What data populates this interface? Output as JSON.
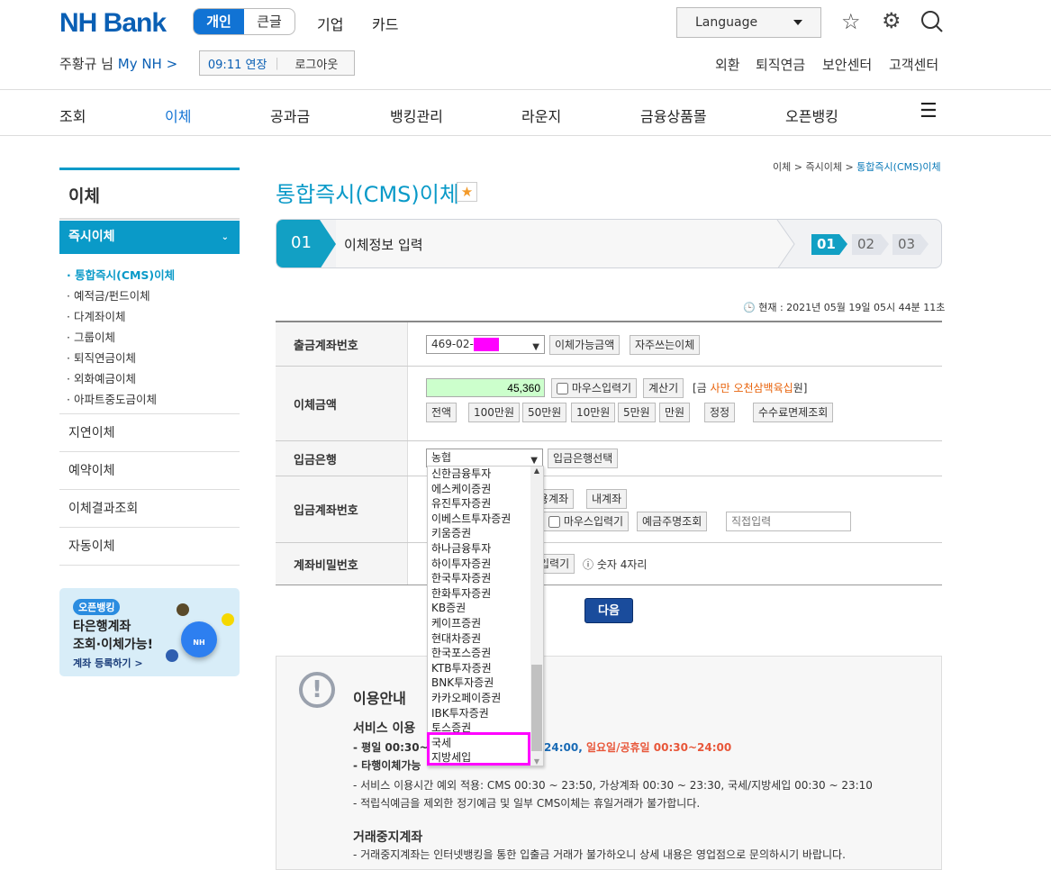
{
  "header": {
    "logo": "NH Bank",
    "segments": [
      "개인",
      "큰글"
    ],
    "nav": [
      "기업",
      "카드"
    ],
    "language": "Language",
    "user": "주황규 님",
    "my_nh": "My NH >",
    "session_extend": "09:11 연장",
    "logout": "로그아웃",
    "util": [
      "외환",
      "퇴직연금",
      "보안센터",
      "고객센터"
    ]
  },
  "gnb": [
    "조회",
    "이체",
    "공과금",
    "뱅킹관리",
    "라운지",
    "금융상품몰",
    "오픈뱅킹"
  ],
  "sidebar": {
    "title": "이체",
    "active": "즉시이체",
    "subitems": [
      "· 통합즉시(CMS)이체",
      "· 예적금/펀드이체",
      "· 다계좌이체",
      "· 그룹이체",
      "· 퇴직연금이체",
      "· 외화예금이체",
      "· 아파트중도금이체"
    ],
    "items": [
      "지연이체",
      "예약이체",
      "이체결과조회",
      "자동이체"
    ],
    "banner": {
      "badge": "오픈뱅킹",
      "line1": "타은행계좌",
      "line2": "조회·이체가능!",
      "link": "계좌 등록하기 >",
      "coin": "NH"
    }
  },
  "breadcrumb": [
    "이체 >",
    "즉시이체 >",
    "통합즉시(CMS)이체"
  ],
  "page_title": "통합즉시(CMS)이체",
  "steps": {
    "current_num": "01",
    "current_label": "이체정보 입력",
    "indicators": [
      "01",
      "02",
      "03"
    ]
  },
  "now": "현재 : 2021년 05월 19일 05시 44분 11초",
  "form": {
    "from_account": {
      "label": "출금계좌번호",
      "value": "469-02-",
      "btns": [
        "이체가능금액",
        "자주쓰는이체"
      ]
    },
    "amount": {
      "label": "이체금액",
      "value": "45,360",
      "mouse": "마우스입력기",
      "calc": "계산기",
      "korean_pre": "[금 ",
      "korean": "사만 오천삼백육십",
      "korean_post": "원]",
      "quick": [
        "전액",
        "100만원",
        "50만원",
        "10만원",
        "5만원",
        "만원",
        "정정"
      ],
      "fee": "수수료면제조회"
    },
    "bank": {
      "label": "입금은행",
      "value": "농협",
      "btn": "입금은행선택"
    },
    "to_account": {
      "label": "입금계좌번호",
      "btns": [
        "용계좌",
        "내계좌"
      ],
      "mouse": "마우스입력기",
      "name_check": "예금주명조회",
      "direct_placeholder": "직접입력"
    },
    "password": {
      "label": "계좌비밀번호",
      "mouse": "입력기",
      "hint": "숫자 4자리"
    }
  },
  "dropdown_options": [
    "신한금융투자",
    "에스케이증권",
    "유진투자증권",
    "이베스트투자증권",
    "키움증권",
    "하나금융투자",
    "하이투자증권",
    "한국투자증권",
    "한화투자증권",
    "KB증권",
    "케이프증권",
    "현대차증권",
    "한국포스증권",
    "KTB투자증권",
    "BNK투자증권",
    "카카오페이증권",
    "IBK투자증권",
    "토스증권",
    "국세",
    "지방세입"
  ],
  "next": "다음",
  "info": {
    "title": "이용안내",
    "service_title": "서비스 이용",
    "l1a": "- 평일 00:30~",
    "l1b": "24:00,",
    "l1c": "일요일/공휴일 00:30~24:00",
    "l2": "- 타행이체가능",
    "l3": "- 서비스 이용시간 예외 적용: CMS 00:30 ~ 23:50, 가상계좌 00:30 ~ 23:30, 국세/지방세입 00:30 ~ 23:10",
    "l4": "- 적립식예금을 제외한 정기예금 및 일부 CMS이체는 휴일거래가 불가합니다.",
    "stop_title": "거래중지계좌",
    "l5": "- 거래중지계좌는 인터넷뱅킹을 통한 입출금 거래가 불가하오니 상세 내용은 영업점으로 문의하시기 바랍니다."
  },
  "colors": {
    "accent": "#0a9ac8",
    "brand": "#0a5fb4",
    "highlight": "#ff00ff",
    "amount_bg": "#ccffcc",
    "warn": "#e8573a"
  }
}
